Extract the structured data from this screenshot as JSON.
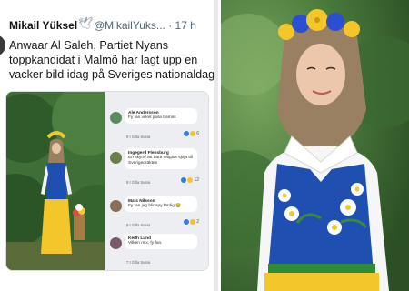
{
  "tweet": {
    "author": "Mikail Yüksel",
    "handle": "@MikailYuks... · 17 h",
    "text_lines": [
      "Anwaar Al Saleh, Partiet Nyans",
      "toppkandidat i Malmö har lagt upp en",
      "vacker bild idag på Sveriges nationaldag."
    ]
  },
  "comments": [
    {
      "name": "Ale Andersson",
      "lines": [
        "Fy fan vilket jävla tramss"
      ],
      "meta": "9 t   Gilla   Svara",
      "count": "6"
    },
    {
      "name": "Ingegerd Flensburg",
      "lines": [
        "En skymf att bära religiös sjöja till",
        "Sverigedräkten"
      ],
      "meta": "9 t   Gilla   Svara",
      "count": "12"
    },
    {
      "name": "Mats Nilsson",
      "lines": [
        "Fy fan jag blir spy färdig 🤮"
      ],
      "meta": "9 t   Gilla   Svara",
      "count": "2"
    },
    {
      "name": "Keith Lund",
      "lines": [
        "Vilken mix, fy fan."
      ],
      "meta": "7 t   Gilla   Svara",
      "count": ""
    }
  ],
  "colors": {
    "blue": "#1f4fb0",
    "yellow": "#f3c72b",
    "hijab": "#9a8062",
    "foliage": "#4a7a3c"
  },
  "icons": [
    "verified-icon"
  ]
}
